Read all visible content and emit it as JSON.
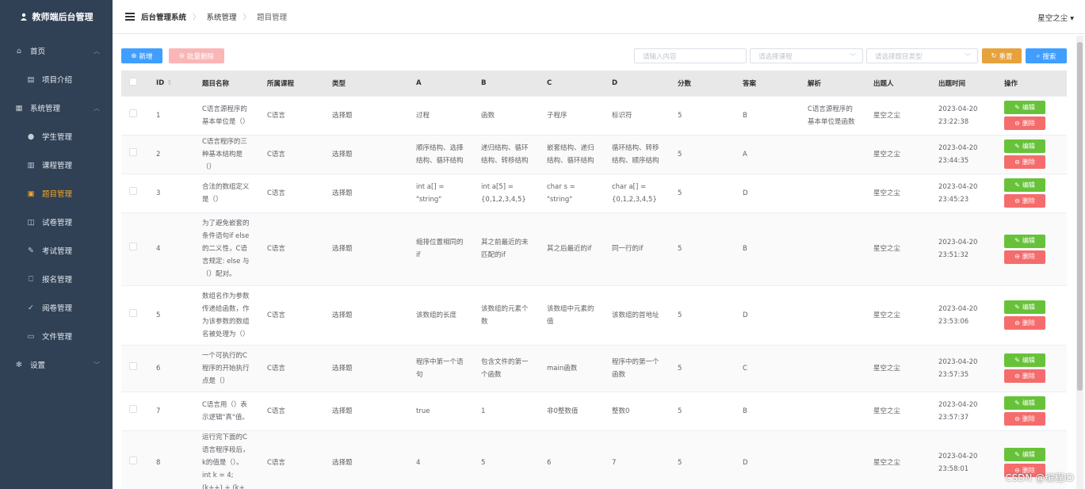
{
  "sidebar": {
    "brand": "教师端后台管理",
    "items": [
      {
        "label": "首页",
        "icon": "home-icon",
        "level": "top",
        "caret": "︿"
      },
      {
        "label": "项目介绍",
        "icon": "doc-icon",
        "level": "sub"
      },
      {
        "label": "系统管理",
        "icon": "grid-icon",
        "level": "top",
        "caret": "︿"
      },
      {
        "label": "学生管理",
        "icon": "user-icon",
        "level": "sub"
      },
      {
        "label": "课程管理",
        "icon": "calendar-icon",
        "level": "sub"
      },
      {
        "label": "题目管理",
        "icon": "note-icon",
        "level": "sub",
        "active": true
      },
      {
        "label": "试卷管理",
        "icon": "book-icon",
        "level": "sub"
      },
      {
        "label": "考试管理",
        "icon": "edit-icon",
        "level": "sub"
      },
      {
        "label": "报名管理",
        "icon": "bookmark-icon",
        "level": "sub"
      },
      {
        "label": "阅卷管理",
        "icon": "grade-icon",
        "level": "sub"
      },
      {
        "label": "文件管理",
        "icon": "folder-icon",
        "level": "sub"
      },
      {
        "label": "设置",
        "icon": "settings-icon",
        "level": "top",
        "caret": "﹀"
      }
    ]
  },
  "header": {
    "crumbs": [
      "后台管理系统",
      "系统管理",
      "题目管理"
    ],
    "user": "星空之尘 ▾"
  },
  "toolbar": {
    "add_label": "新增",
    "batch_delete_label": "批量删除",
    "search_placeholder": "请输入内容",
    "course_placeholder": "请选择课程",
    "type_placeholder": "请选择题目类型",
    "reset_label": "重置",
    "search_label": "搜索"
  },
  "table": {
    "headers": [
      "",
      "ID",
      "题目名称",
      "所属课程",
      "类型",
      "A",
      "B",
      "C",
      "D",
      "分数",
      "答案",
      "解析",
      "出题人",
      "出题时间",
      "操作"
    ],
    "edit_label": "编辑",
    "delete_label": "删除",
    "rows": [
      {
        "id": "1",
        "name": "C语言源程序的基本单位是（）",
        "course": "C语言",
        "type": "选择题",
        "a": "过程",
        "b": "函数",
        "c": "子程序",
        "d": "标识符",
        "score": "5",
        "answer": "B",
        "analysis": "C语言源程序的基本单位是函数",
        "author": "星空之尘",
        "time": "2023-04-20 23:22:38"
      },
      {
        "id": "2",
        "name": "C语言程序的三种基本结构是（）",
        "course": "C语言",
        "type": "选择题",
        "a": "顺序结构、选择结构、循环结构",
        "b": "递归结构、循环结构、转移结构",
        "c": "嵌套结构、递归结构、循环结构",
        "d": "循环结构、转移结构、顺序结构",
        "score": "5",
        "answer": "A",
        "analysis": "",
        "author": "星空之尘",
        "time": "2023-04-20 23:44:35"
      },
      {
        "id": "3",
        "name": "合法的数组定义是（）",
        "course": "C语言",
        "type": "选择题",
        "a": "int a[] = \"string\"",
        "b": "int a[5] = {0,1,2,3,4,5}",
        "c": "char s = \"string\"",
        "d": "char a[] = {0,1,2,3,4,5}",
        "score": "5",
        "answer": "D",
        "analysis": "",
        "author": "星空之尘",
        "time": "2023-04-20 23:45:23"
      },
      {
        "id": "4",
        "name": "为了避免嵌套的条件语句if else的二义性，C语言规定: else 与（）配对。",
        "course": "C语言",
        "type": "选择题",
        "a": "缩排位置相同的if",
        "b": "其之前最近的未匹配的if",
        "c": "其之后最近的if",
        "d": "同一行的if",
        "score": "5",
        "answer": "B",
        "analysis": "",
        "author": "星空之尘",
        "time": "2023-04-20 23:51:32"
      },
      {
        "id": "5",
        "name": "数组名作为参数传递给函数，作为该参数的数组名被处理为（）",
        "course": "C语言",
        "type": "选择题",
        "a": "该数组的长度",
        "b": "该数组的元素个数",
        "c": "该数组中元素的值",
        "d": "该数组的首地址",
        "score": "5",
        "answer": "D",
        "analysis": "",
        "author": "星空之尘",
        "time": "2023-04-20 23:53:06"
      },
      {
        "id": "6",
        "name": "一个可执行的C程序的开始执行点是（）",
        "course": "C语言",
        "type": "选择题",
        "a": "程序中第一个语句",
        "b": "包含文件的第一个函数",
        "c": "main函数",
        "d": "程序中的第一个函数",
        "score": "5",
        "answer": "C",
        "analysis": "",
        "author": "星空之尘",
        "time": "2023-04-20 23:57:35"
      },
      {
        "id": "7",
        "name": "C语言用（）表示逻辑\"真\"值。",
        "course": "C语言",
        "type": "选择题",
        "a": "true",
        "b": "1",
        "c": "非0整数值",
        "d": "整数0",
        "score": "5",
        "answer": "B",
        "analysis": "",
        "author": "星空之尘",
        "time": "2023-04-20 23:57:37"
      },
      {
        "id": "8",
        "name": "运行完下面的C语言程序段后，k的值是（）。int k = 4; (k++) + (k+",
        "course": "C语言",
        "type": "选择题",
        "a": "4",
        "b": "5",
        "c": "6",
        "d": "7",
        "score": "5",
        "answer": "D",
        "analysis": "",
        "author": "星空之尘",
        "time": "2023-04-20 23:58:01"
      }
    ]
  },
  "watermark": "CSDN @编程ID",
  "colors": {
    "sidebar_bg": "#304156",
    "active": "#f5a623",
    "primary": "#409eff",
    "danger": "#f56c6c",
    "success": "#67c23a",
    "warning": "#e6a23c"
  }
}
